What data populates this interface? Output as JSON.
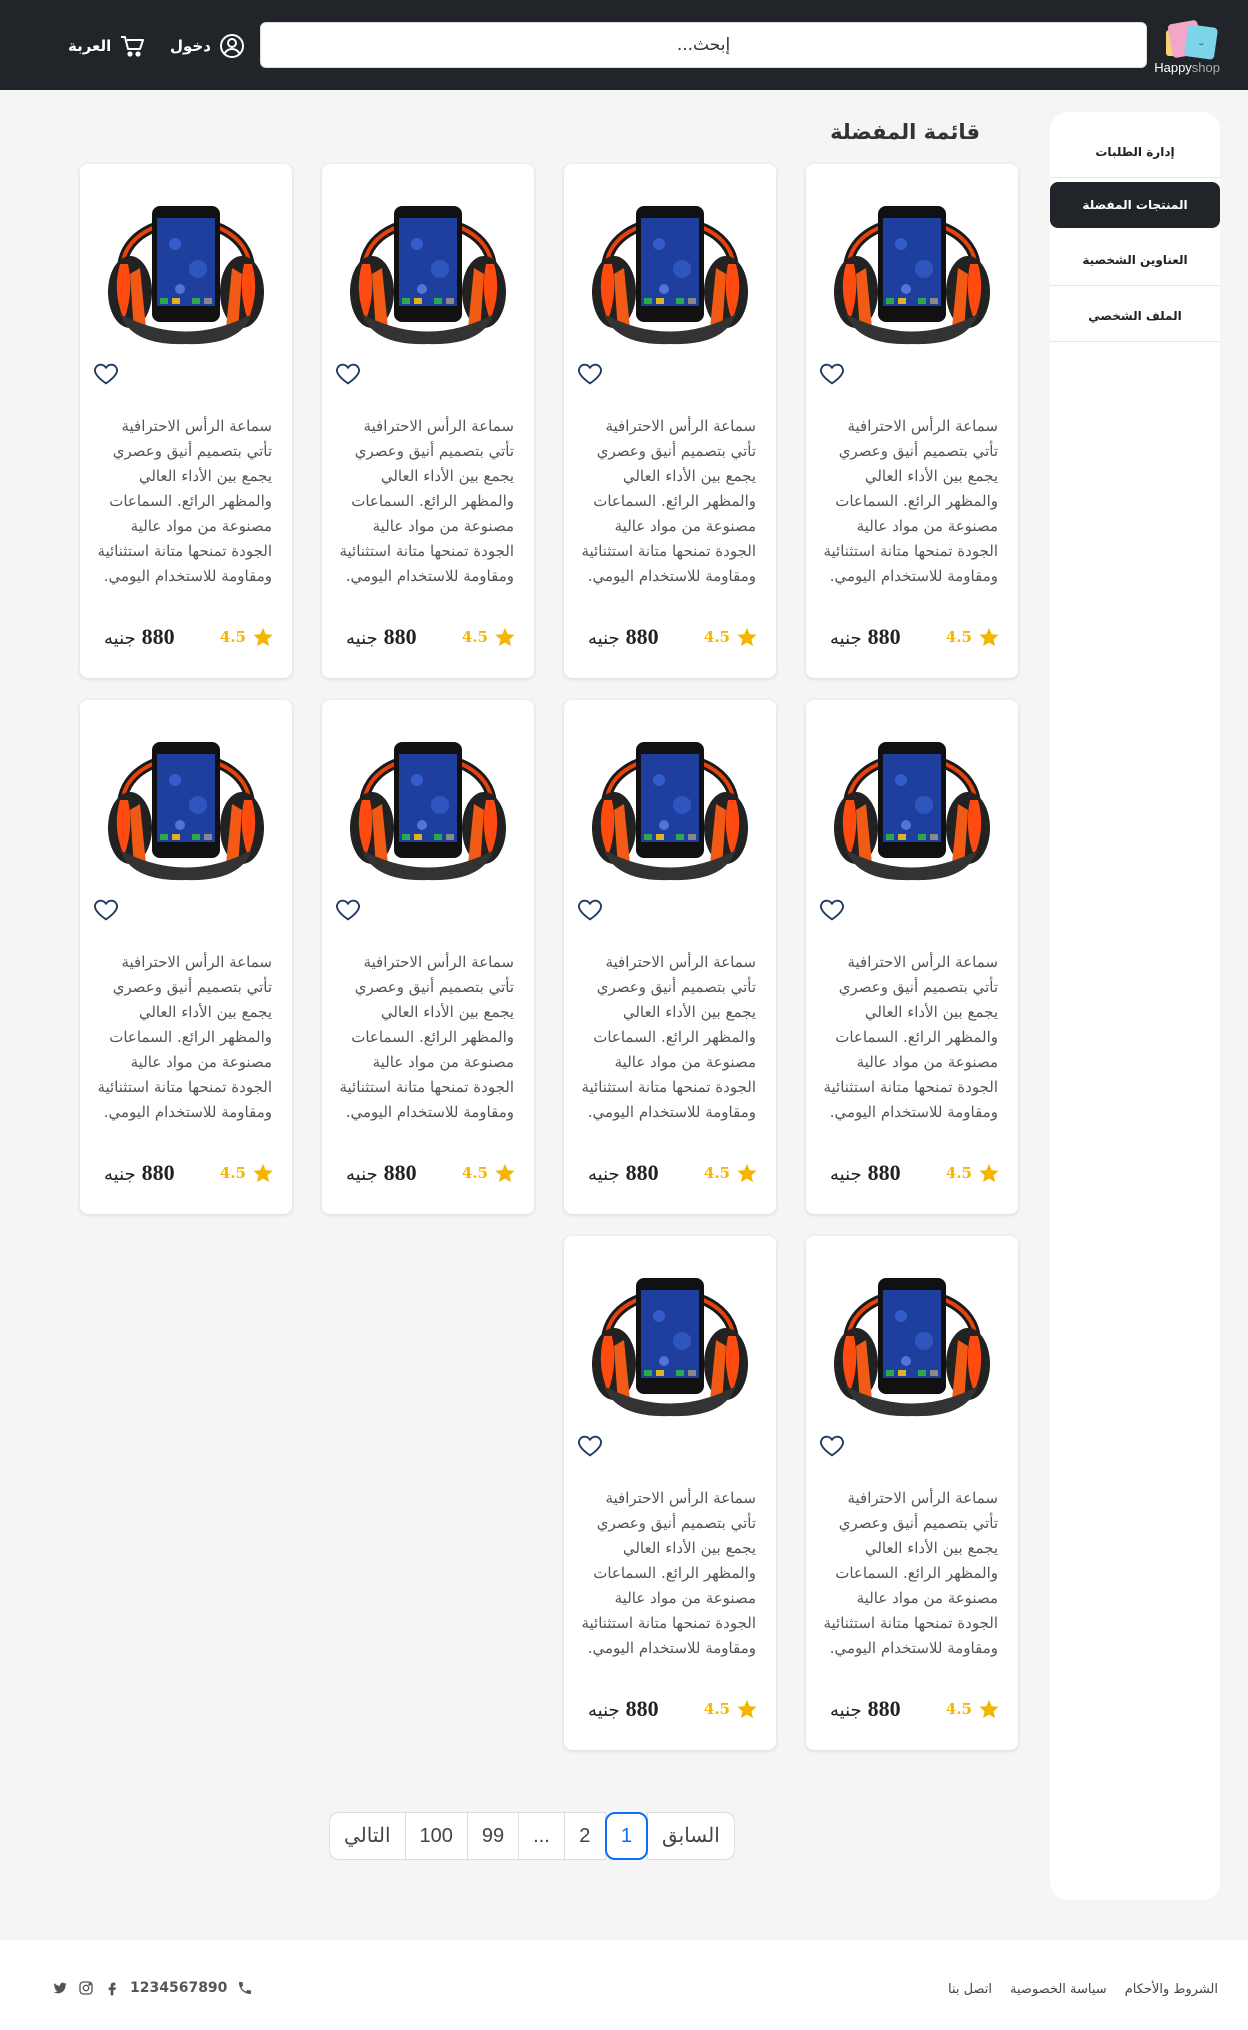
{
  "header": {
    "brand": "Happy",
    "brand_suffix": "shop",
    "search_placeholder": "إبحث...",
    "login_label": "دخول",
    "cart_label": "العربة"
  },
  "sidebar": {
    "items": [
      {
        "label": "إدارة الطلبات",
        "active": false
      },
      {
        "label": "المنتجات المفضلة",
        "active": true
      },
      {
        "label": "العناوين الشخصية",
        "active": false
      },
      {
        "label": "الملف الشخصي",
        "active": false
      }
    ]
  },
  "main": {
    "title": "قائمة المفضلة",
    "products": [
      {
        "description": "سماعة الرأس الاحترافية تأتي بتصميم أنيق وعصري يجمع بين الأداء العالي والمظهر الرائع. السماعات مصنوعة من مواد عالية الجودة تمنحها متانة استثنائية ومقاومة للاستخدام اليومي.",
        "rating": "4.5",
        "price": "880",
        "currency": "جنيه"
      },
      {
        "description": "سماعة الرأس الاحترافية تأتي بتصميم أنيق وعصري يجمع بين الأداء العالي والمظهر الرائع. السماعات مصنوعة من مواد عالية الجودة تمنحها متانة استثنائية ومقاومة للاستخدام اليومي.",
        "rating": "4.5",
        "price": "880",
        "currency": "جنيه"
      },
      {
        "description": "سماعة الرأس الاحترافية تأتي بتصميم أنيق وعصري يجمع بين الأداء العالي والمظهر الرائع. السماعات مصنوعة من مواد عالية الجودة تمنحها متانة استثنائية ومقاومة للاستخدام اليومي.",
        "rating": "4.5",
        "price": "880",
        "currency": "جنيه"
      },
      {
        "description": "سماعة الرأس الاحترافية تأتي بتصميم أنيق وعصري يجمع بين الأداء العالي والمظهر الرائع. السماعات مصنوعة من مواد عالية الجودة تمنحها متانة استثنائية ومقاومة للاستخدام اليومي.",
        "rating": "4.5",
        "price": "880",
        "currency": "جنيه"
      },
      {
        "description": "سماعة الرأس الاحترافية تأتي بتصميم أنيق وعصري يجمع بين الأداء العالي والمظهر الرائع. السماعات مصنوعة من مواد عالية الجودة تمنحها متانة استثنائية ومقاومة للاستخدام اليومي.",
        "rating": "4.5",
        "price": "880",
        "currency": "جنيه"
      },
      {
        "description": "سماعة الرأس الاحترافية تأتي بتصميم أنيق وعصري يجمع بين الأداء العالي والمظهر الرائع. السماعات مصنوعة من مواد عالية الجودة تمنحها متانة استثنائية ومقاومة للاستخدام اليومي.",
        "rating": "4.5",
        "price": "880",
        "currency": "جنيه"
      },
      {
        "description": "سماعة الرأس الاحترافية تأتي بتصميم أنيق وعصري يجمع بين الأداء العالي والمظهر الرائع. السماعات مصنوعة من مواد عالية الجودة تمنحها متانة استثنائية ومقاومة للاستخدام اليومي.",
        "rating": "4.5",
        "price": "880",
        "currency": "جنيه"
      },
      {
        "description": "سماعة الرأس الاحترافية تأتي بتصميم أنيق وعصري يجمع بين الأداء العالي والمظهر الرائع. السماعات مصنوعة من مواد عالية الجودة تمنحها متانة استثنائية ومقاومة للاستخدام اليومي.",
        "rating": "4.5",
        "price": "880",
        "currency": "جنيه"
      },
      {
        "description": "سماعة الرأس الاحترافية تأتي بتصميم أنيق وعصري يجمع بين الأداء العالي والمظهر الرائع. السماعات مصنوعة من مواد عالية الجودة تمنحها متانة استثنائية ومقاومة للاستخدام اليومي.",
        "rating": "4.5",
        "price": "880",
        "currency": "جنيه"
      },
      {
        "description": "سماعة الرأس الاحترافية تأتي بتصميم أنيق وعصري يجمع بين الأداء العالي والمظهر الرائع. السماعات مصنوعة من مواد عالية الجودة تمنحها متانة استثنائية ومقاومة للاستخدام اليومي.",
        "rating": "4.5",
        "price": "880",
        "currency": "جنيه"
      }
    ]
  },
  "pagination": {
    "prev_label": "السابق",
    "pages": [
      "1",
      "2",
      "...",
      "99",
      "100"
    ],
    "current": "1",
    "next_label": "التالي"
  },
  "footer": {
    "links": [
      "الشروط والأحكام",
      "سياسة الخصوصية",
      "اتصل بنا"
    ],
    "phone": "1234567890",
    "social_icons": [
      "twitter-icon",
      "instagram-icon",
      "facebook-icon"
    ]
  },
  "colors": {
    "header_bg": "#212529",
    "active_bg": "#212529",
    "star": "#f4b400",
    "pager_active": "#0d6efd"
  }
}
